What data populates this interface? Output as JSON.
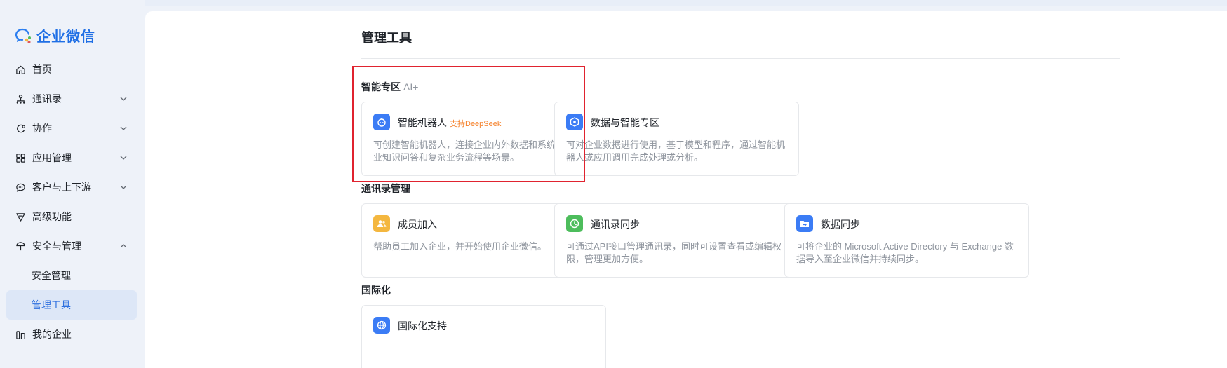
{
  "app": {
    "name": "企业微信"
  },
  "sidebar": {
    "items": [
      {
        "label": "首页",
        "icon": "home-icon"
      },
      {
        "label": "通讯录",
        "icon": "org-chart-icon"
      },
      {
        "label": "协作",
        "icon": "collaboration-icon"
      },
      {
        "label": "应用管理",
        "icon": "apps-grid-icon"
      },
      {
        "label": "客户与上下游",
        "icon": "chat-bubble-icon"
      },
      {
        "label": "高级功能",
        "icon": "advanced-icon"
      },
      {
        "label": "安全与管理",
        "icon": "shield-icon"
      },
      {
        "label": "安全管理"
      },
      {
        "label": "管理工具"
      },
      {
        "label": "我的企业",
        "icon": "enterprise-icon"
      }
    ]
  },
  "main": {
    "title": "管理工具",
    "sections": [
      {
        "title": "智能专区",
        "tag": "AI+",
        "cards": [
          {
            "title": "智能机器人",
            "badge": "支持DeepSeek",
            "desc": "可创建智能机器人，连接企业内外数据和系统，满足企业知识问答和复杂业务流程等场景。",
            "icon": "robot-icon",
            "color": "#3b7cf5"
          },
          {
            "title": "数据与智能专区",
            "desc": "可对企业数据进行使用，基于模型和程序，通过智能机器人或应用调用完成处理或分析。",
            "icon": "data-cube-icon",
            "color": "#3b7cf5"
          }
        ]
      },
      {
        "title": "通讯录管理",
        "cards": [
          {
            "title": "成员加入",
            "desc": "帮助员工加入企业，并开始使用企业微信。",
            "icon": "members-icon",
            "color": "#f4b73f"
          },
          {
            "title": "通讯录同步",
            "desc": "可通过API接口管理通讯录，同时可设置查看或编辑权限，管理更加方便。",
            "icon": "sync-icon",
            "color": "#4dbd5c"
          },
          {
            "title": "数据同步",
            "desc": "可将企业的 Microsoft Active Directory 与 Exchange 数据导入至企业微信并持续同步。",
            "icon": "folder-sync-icon",
            "color": "#3b7cf5"
          }
        ]
      },
      {
        "title": "国际化",
        "cards": [
          {
            "title": "国际化支持",
            "icon": "globe-icon",
            "color": "#3b7cf5"
          }
        ]
      }
    ]
  },
  "colors": {
    "accent": "#2d6fdf",
    "highlight_border": "#e0232f",
    "badge": "#f5812b"
  }
}
